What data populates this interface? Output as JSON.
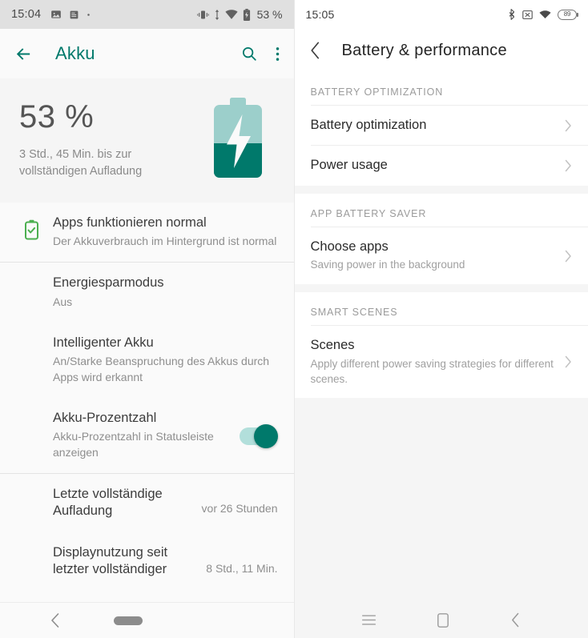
{
  "left_phone": {
    "status_bar": {
      "time": "15:04",
      "left_icons": [
        "image-icon",
        "document-icon",
        "dot-icon"
      ],
      "right_icons": [
        "vibrate-icon",
        "data-transfer-icon",
        "wifi-icon",
        "battery-charging-icon"
      ],
      "battery_percent": "53 %"
    },
    "appbar": {
      "back_icon": "arrow-back-icon",
      "title": "Akku",
      "search_icon": "search-icon",
      "overflow_icon": "more-vert-icon"
    },
    "hero": {
      "percent": "53 %",
      "subtitle": "3 Std., 45 Min. bis zur vollständigen Aufladung",
      "battery_icon": "battery-charging-large-icon"
    },
    "rows": [
      {
        "icon": "battery-ok-icon",
        "title": "Apps funktionieren normal",
        "sub": "Der Akkuverbrauch im Hintergrund ist normal",
        "value": "",
        "toggle": false
      },
      {
        "icon": "",
        "title": "Energiesparmodus",
        "sub": "Aus",
        "value": "",
        "toggle": false
      },
      {
        "icon": "",
        "title": "Intelligenter Akku",
        "sub": "An/Starke Beanspruchung des Akkus durch Apps wird erkannt",
        "value": "",
        "toggle": false
      },
      {
        "icon": "",
        "title": "Akku-Prozentzahl",
        "sub": "Akku-Prozentzahl in Statusleiste anzeigen",
        "value": "",
        "toggle": true
      },
      {
        "icon": "",
        "title": "Letzte vollständige Aufladung",
        "sub": "",
        "value": "vor 26 Stunden",
        "toggle": false
      },
      {
        "icon": "",
        "title": "Displaynutzung seit letzter vollständiger",
        "sub": "",
        "value": "8 Std., 11 Min.",
        "toggle": false
      }
    ],
    "nav_bar": {
      "back_icon": "chevron-back-icon",
      "home_pill": "home-pill-icon"
    },
    "colors": {
      "accent": "#00796b",
      "toggle_track": "#b2dfdb",
      "battery_ok": "#4caf50",
      "status_bg": "#e0e0e0"
    }
  },
  "right_phone": {
    "status_bar": {
      "time": "15:05",
      "right_icons": [
        "bluetooth-icon",
        "no-sim-icon",
        "wifi-icon"
      ],
      "battery_level": "89"
    },
    "appbar": {
      "back_icon": "chevron-back-icon",
      "title": "Battery  &  performance"
    },
    "sections": [
      {
        "label": "BATTERY OPTIMIZATION",
        "items": [
          {
            "title": "Battery optimization",
            "sub": "",
            "chevron": "chevron-right-icon"
          },
          {
            "title": "Power usage",
            "sub": "",
            "chevron": "chevron-right-icon"
          }
        ]
      },
      {
        "label": "APP BATTERY SAVER",
        "items": [
          {
            "title": "Choose apps",
            "sub": "Saving power in the background",
            "chevron": "chevron-right-icon"
          }
        ]
      },
      {
        "label": "SMART SCENES",
        "items": [
          {
            "title": "Scenes",
            "sub": "Apply different power saving strategies for different scenes.",
            "chevron": "chevron-right-icon"
          }
        ]
      }
    ],
    "nav_bar": {
      "menu_icon": "menu-icon",
      "home_icon": "home-square-icon",
      "back_icon": "chevron-back-icon"
    },
    "colors": {
      "bg": "#f5f5f5",
      "card": "#ffffff",
      "label": "#9b9b9b"
    }
  }
}
